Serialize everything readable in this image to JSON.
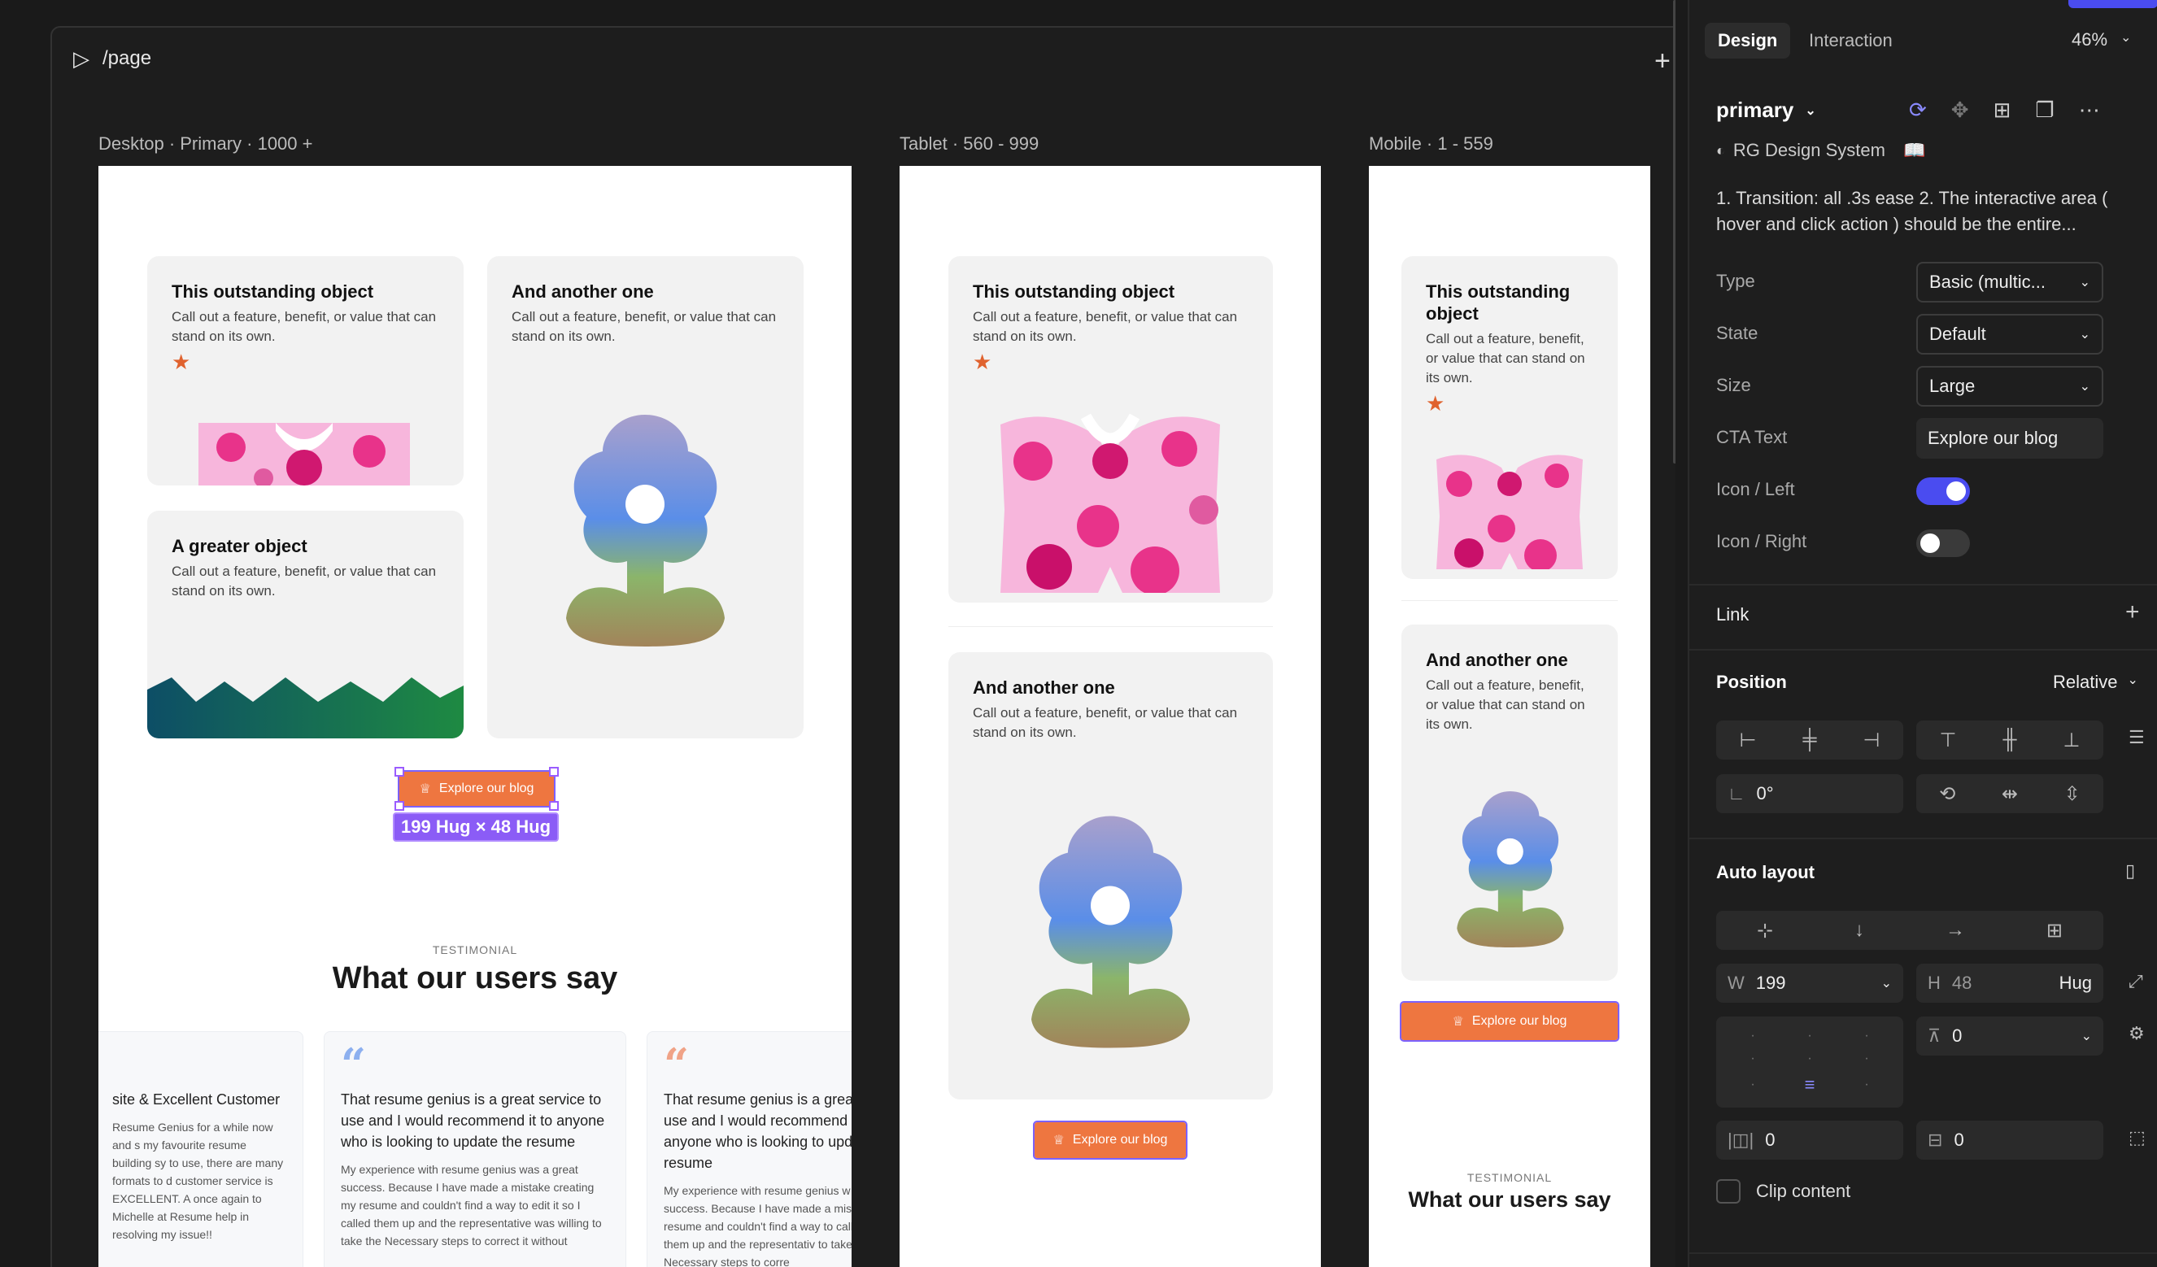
{
  "editor": {
    "page_path": "/page",
    "viewports": {
      "desktop": "Desktop · Primary · 1000 +",
      "tablet": "Tablet · 560 - 999",
      "mobile": "Mobile · 1 - 559"
    }
  },
  "cards": {
    "outstanding_title": "This outstanding object",
    "another_title": "And another one",
    "greater_title": "A greater object",
    "body": "Call out a feature, benefit, or value that can stand on its own."
  },
  "cta_label": "Explore our blog",
  "selection_size": "199 Hug × 48 Hug",
  "testimonial": {
    "eyebrow": "TESTIMONIAL",
    "heading": "What our users say",
    "card1_title": "site & Excellent Customer",
    "card1_body": "Resume Genius for a while now and s my favourite resume building sy to use, there are many formats to d customer service is EXCELLENT. A once again to Michelle at Resume help in resolving my issue!!",
    "quote": "That resume genius is a great service to use and I would recommend it to anyone who is looking to update the resume",
    "quote_cut": "That resume genius is a grea use and I would recommend anyone who is looking to upd resume",
    "body": "My experience with resume genius was a great success. Because I have made a mistake creating my resume and couldn't find a way to edit it so I called them up and the representative was willing to take the Necessary steps to correct it without",
    "body_cut": "My experience with resume genius w success. Because I have made a mist my resume and couldn't find a way to called them up and the representativ to take the Necessary steps to corre"
  },
  "panel": {
    "tabs": [
      "Design",
      "Interaction"
    ],
    "zoom": "46%",
    "component": "primary",
    "library": "RG Design System",
    "description": "1. Transition: all .3s ease 2. The interactive area ( hover and click action ) should be the entire...",
    "props": {
      "type_label": "Type",
      "type_value": "Basic (multic...",
      "state_label": "State",
      "state_value": "Default",
      "size_label": "Size",
      "size_value": "Large",
      "cta_label": "CTA Text",
      "cta_value": "Explore our blog",
      "icon_left_label": "Icon / Left",
      "icon_left_on": true,
      "icon_right_label": "Icon / Right",
      "icon_right_on": false
    },
    "link_label": "Link",
    "position_label": "Position",
    "position_value": "Relative",
    "rotation": "0°",
    "auto_layout_label": "Auto layout",
    "w_label": "W",
    "w_value": "199",
    "h_label": "H",
    "h_value": "48",
    "h_mode": "Hug",
    "gap": "0",
    "pad_h": "0",
    "pad_v": "0",
    "clip_label": "Clip content",
    "accent": "#4a4cf0"
  }
}
